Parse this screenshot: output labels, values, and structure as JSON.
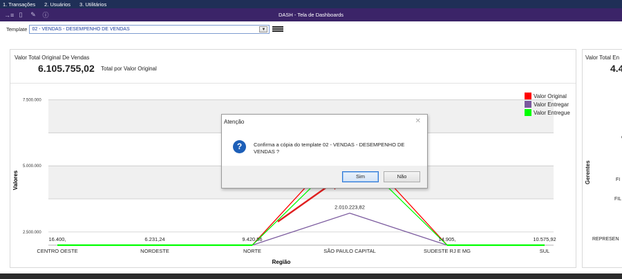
{
  "menu": {
    "items": [
      "1. Transações",
      "2. Usuários",
      "3. Utilitários"
    ]
  },
  "titlebar": {
    "title": "DASH - Tela de Dashboards",
    "icons": [
      "menu-collapse-icon",
      "database-icon",
      "wrench-icon",
      "info-icon"
    ]
  },
  "toolbar": {
    "template_label": "Template",
    "template_value": "02 - VENDAS - DESEMPENHO DE VENDAS"
  },
  "panel_left": {
    "title": "Valor Total Original De Vendas",
    "value": "6.105.755,02",
    "subtitle": "Total por Valor Original"
  },
  "panel_right": {
    "title": "Valor Total En",
    "value": "4.4",
    "ylabel": "Gerentes",
    "categories": [
      "C",
      "FI",
      "FIL",
      "REPRESEN"
    ]
  },
  "chart_data": {
    "type": "line",
    "xlabel": "Região",
    "ylabel": "Valores",
    "categories": [
      "CENTRO OESTE",
      "NORDESTE",
      "NORTE",
      "SÃO PAULO CAPITAL",
      "SUDESTE RJ E MG",
      "SUL"
    ],
    "yticks": [
      "7.500.000",
      "5.000.000",
      "2.500.000"
    ],
    "ylim": [
      2000000,
      7800000
    ],
    "legend_position": "top-right",
    "series": [
      {
        "name": "Valor Original",
        "color": "#ff0000",
        "values": [
          16400,
          6231,
          9420,
          6000000,
          14905,
          10575
        ]
      },
      {
        "name": "Valor Entregar",
        "color": "#7b5a9e",
        "values": [
          16400,
          6231,
          9420,
          3210000,
          14905,
          10575
        ]
      },
      {
        "name": "Valor Entregue",
        "color": "#00ff00",
        "values": [
          16400,
          6231,
          9420,
          5600000,
          14905,
          10575
        ]
      }
    ],
    "data_labels": [
      "16.400,",
      "6.231,24",
      "9.420,56",
      "2.010.223,82",
      "14.905,",
      "10.575,92"
    ]
  },
  "dialog": {
    "title": "Atenção",
    "close_glyph": "✕",
    "icon_glyph": "?",
    "message": "Confirma a cópia do template 02 - VENDAS - DESEMPENHO DE VENDAS ?",
    "yes_label": "Sim",
    "no_label": "Não"
  },
  "colors": {
    "menubar": "#1f2f57",
    "titlebar": "#3b2468",
    "annotation_arrow": "#e02020"
  }
}
